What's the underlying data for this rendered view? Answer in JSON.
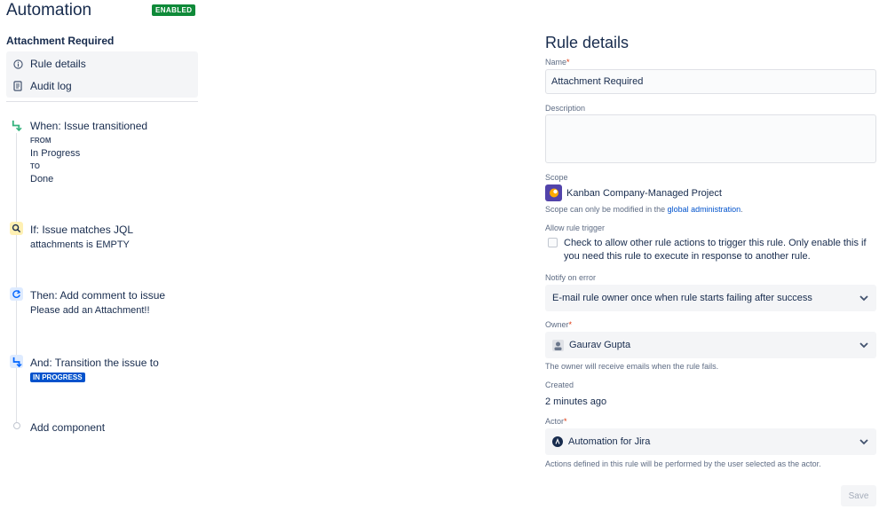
{
  "header": {
    "title": "Automation",
    "status_badge": "ENABLED"
  },
  "sidebar": {
    "rule_name": "Attachment Required",
    "nav": [
      {
        "label": "Rule details",
        "icon": "info-icon"
      },
      {
        "label": "Audit log",
        "icon": "document-icon"
      }
    ]
  },
  "flow": {
    "trigger": {
      "title": "When: Issue transitioned",
      "from_label": "FROM",
      "from_value": "In Progress",
      "to_label": "TO",
      "to_value": "Done",
      "icon": "transition-icon",
      "color": "#36b37e"
    },
    "condition": {
      "title": "If: Issue matches JQL",
      "detail": "attachments is EMPTY",
      "icon": "search-icon",
      "color": "#ffc400"
    },
    "action_comment": {
      "title": "Then: Add comment to issue",
      "detail": "Please add an Attachment!!",
      "icon": "refresh-icon",
      "color": "#0065ff"
    },
    "action_transition": {
      "title": "And: Transition the issue to",
      "status": "IN PROGRESS",
      "icon": "transition-icon",
      "color": "#0065ff"
    },
    "add_component": "Add component"
  },
  "details": {
    "heading": "Rule details",
    "name_label": "Name",
    "name_value": "Attachment Required",
    "required_mark": "*",
    "description_label": "Description",
    "description_value": "",
    "scope_label": "Scope",
    "scope_value": "Kanban Company-Managed Project",
    "scope_help_prefix": "Scope can only be modified in the",
    "scope_help_link": "global administration",
    "scope_help_suffix": ".",
    "allow_trigger_label": "Allow rule trigger",
    "allow_trigger_text": "Check to allow other rule actions to trigger this rule. Only enable this if you need this rule to execute in response to another rule.",
    "allow_trigger_checked": false,
    "notify_label": "Notify on error",
    "notify_value": "E-mail rule owner once when rule starts failing after success",
    "owner_label": "Owner",
    "owner_value": "Gaurav Gupta",
    "owner_help": "The owner will receive emails when the rule fails.",
    "created_label": "Created",
    "created_value": "2 minutes ago",
    "actor_label": "Actor",
    "actor_value": "Automation for Jira",
    "actor_help": "Actions defined in this rule will be performed by the user selected as the actor.",
    "save_label": "Save"
  },
  "colors": {
    "enabled_green": "#0f8a39",
    "link_blue": "#0052cc",
    "status_blue": "#0052cc",
    "project_purple": "#5243aa"
  }
}
